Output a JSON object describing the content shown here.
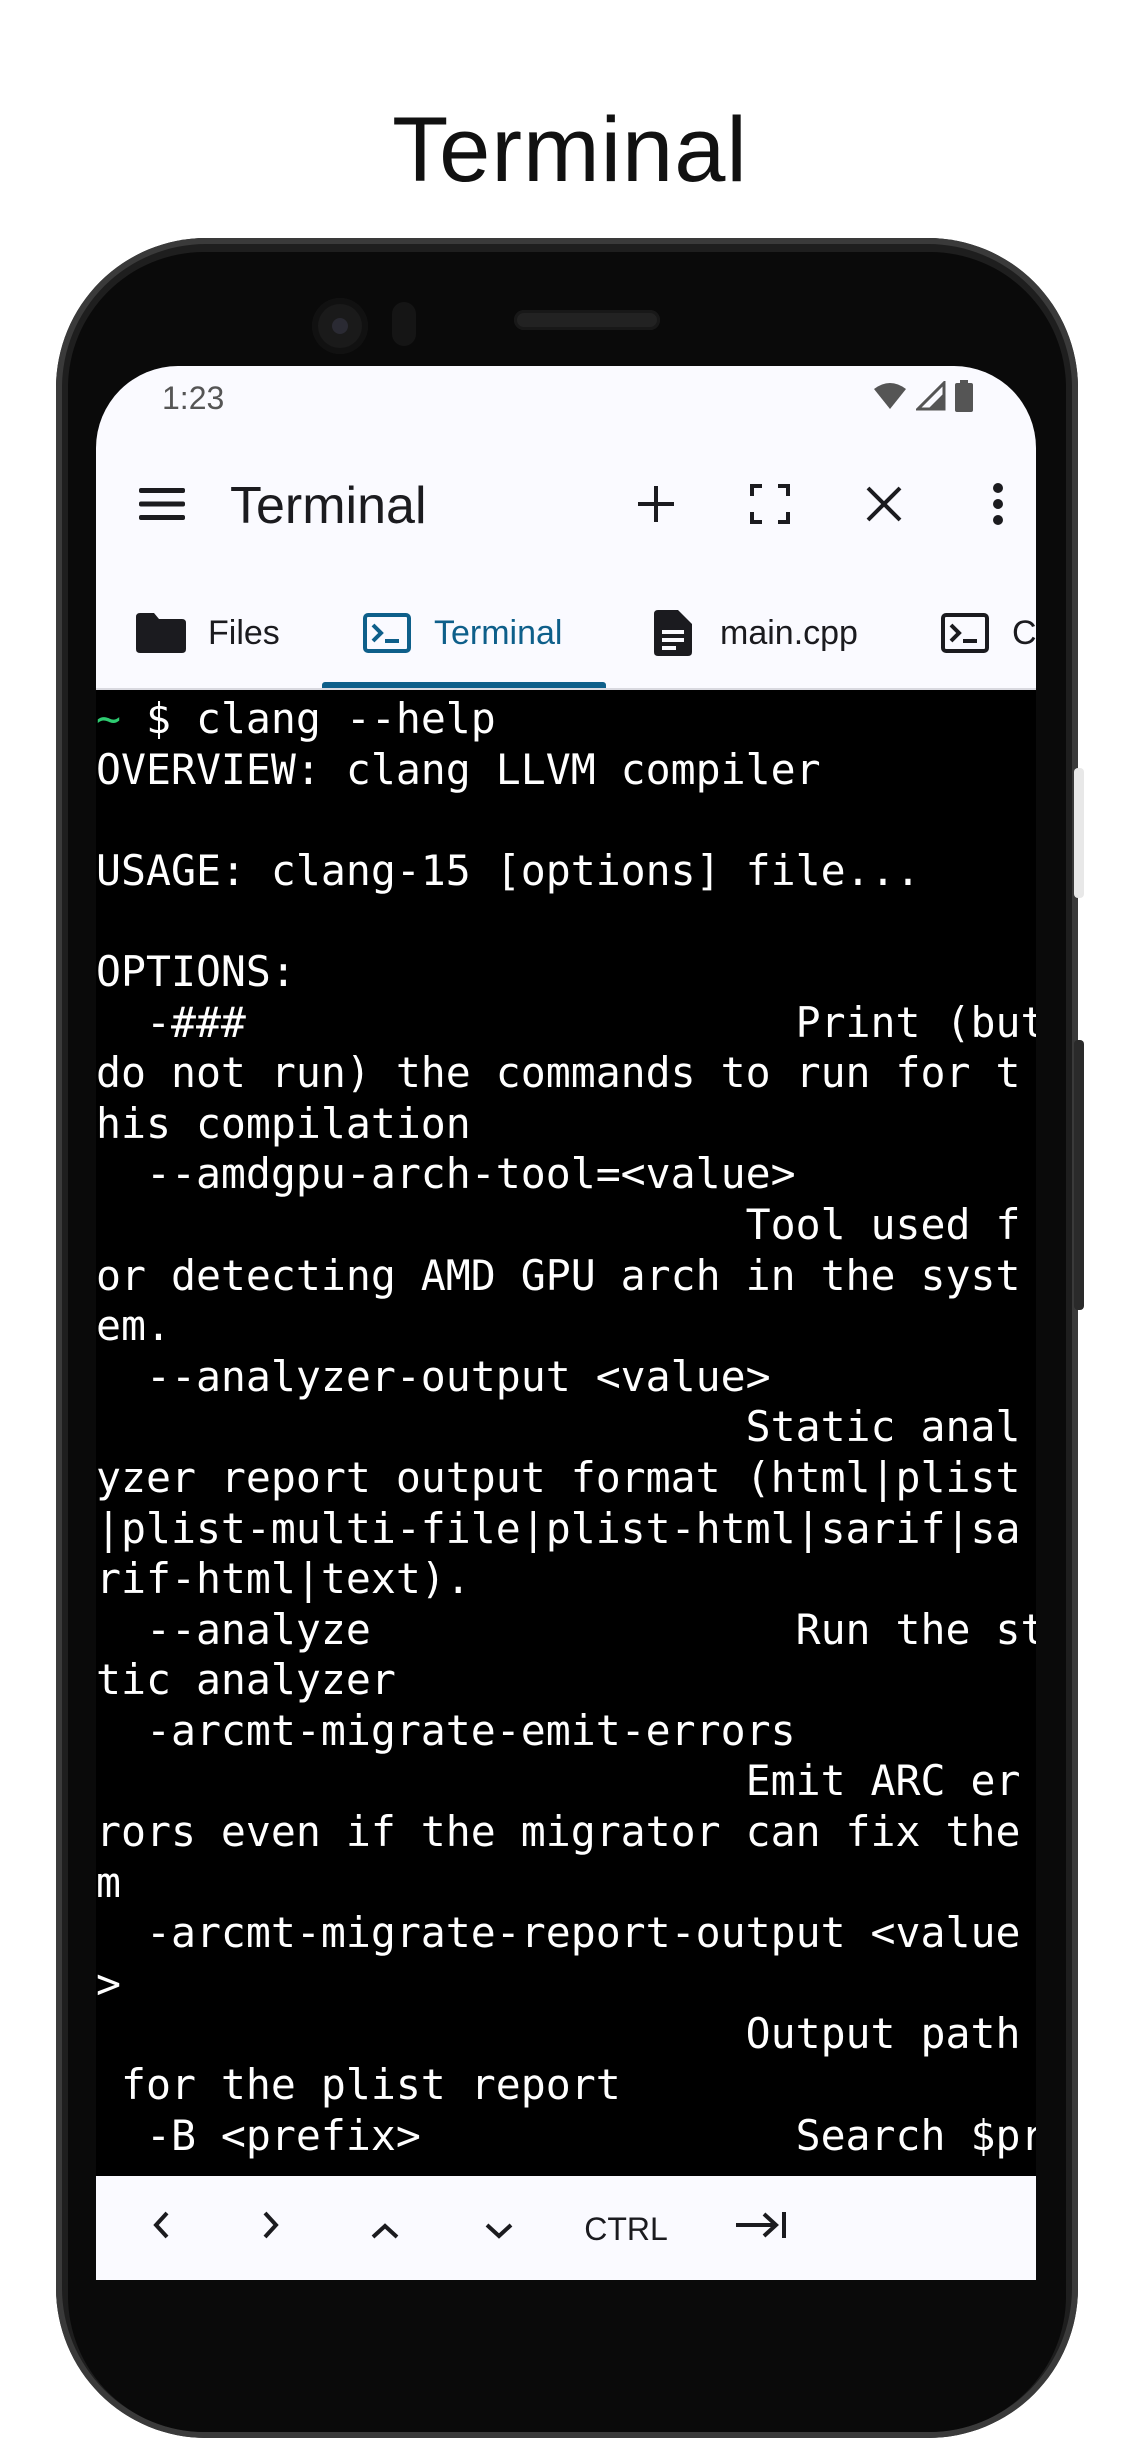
{
  "page": {
    "title": "Terminal"
  },
  "status": {
    "time": "1:23"
  },
  "appbar": {
    "title": "Terminal"
  },
  "tabs": [
    {
      "label": "Files",
      "icon": "folder-icon",
      "active": false
    },
    {
      "label": "Terminal",
      "icon": "terminal-icon",
      "active": true
    },
    {
      "label": "main.cpp",
      "icon": "document-icon",
      "active": false
    },
    {
      "label": "C",
      "icon": "terminal-icon",
      "active": false
    }
  ],
  "terminal": {
    "prompt_symbol": "~",
    "command": " $ clang --help",
    "lines": [
      "OVERVIEW: clang LLVM compiler",
      "",
      "USAGE: clang-15 [options] file...",
      "",
      "OPTIONS:",
      "  -###                      Print (but ",
      "do not run) the commands to run for t",
      "his compilation",
      "  --amdgpu-arch-tool=<value>",
      "                          Tool used f",
      "or detecting AMD GPU arch in the syst",
      "em.",
      "  --analyzer-output <value>",
      "                          Static anal",
      "yzer report output format (html|plist",
      "|plist-multi-file|plist-html|sarif|sa",
      "rif-html|text).",
      "  --analyze                 Run the sta",
      "tic analyzer",
      "  -arcmt-migrate-emit-errors",
      "                          Emit ARC er",
      "rors even if the migrator can fix the",
      "m",
      "  -arcmt-migrate-report-output <value",
      ">",
      "                          Output path",
      " for the plist report",
      "  -B <prefix>               Search $pre"
    ]
  },
  "keybar": {
    "ctrl_label": "CTRL"
  },
  "colors": {
    "accent": "#0e5f8a",
    "prompt": "#2ecc71",
    "surface": "#fafaff"
  }
}
